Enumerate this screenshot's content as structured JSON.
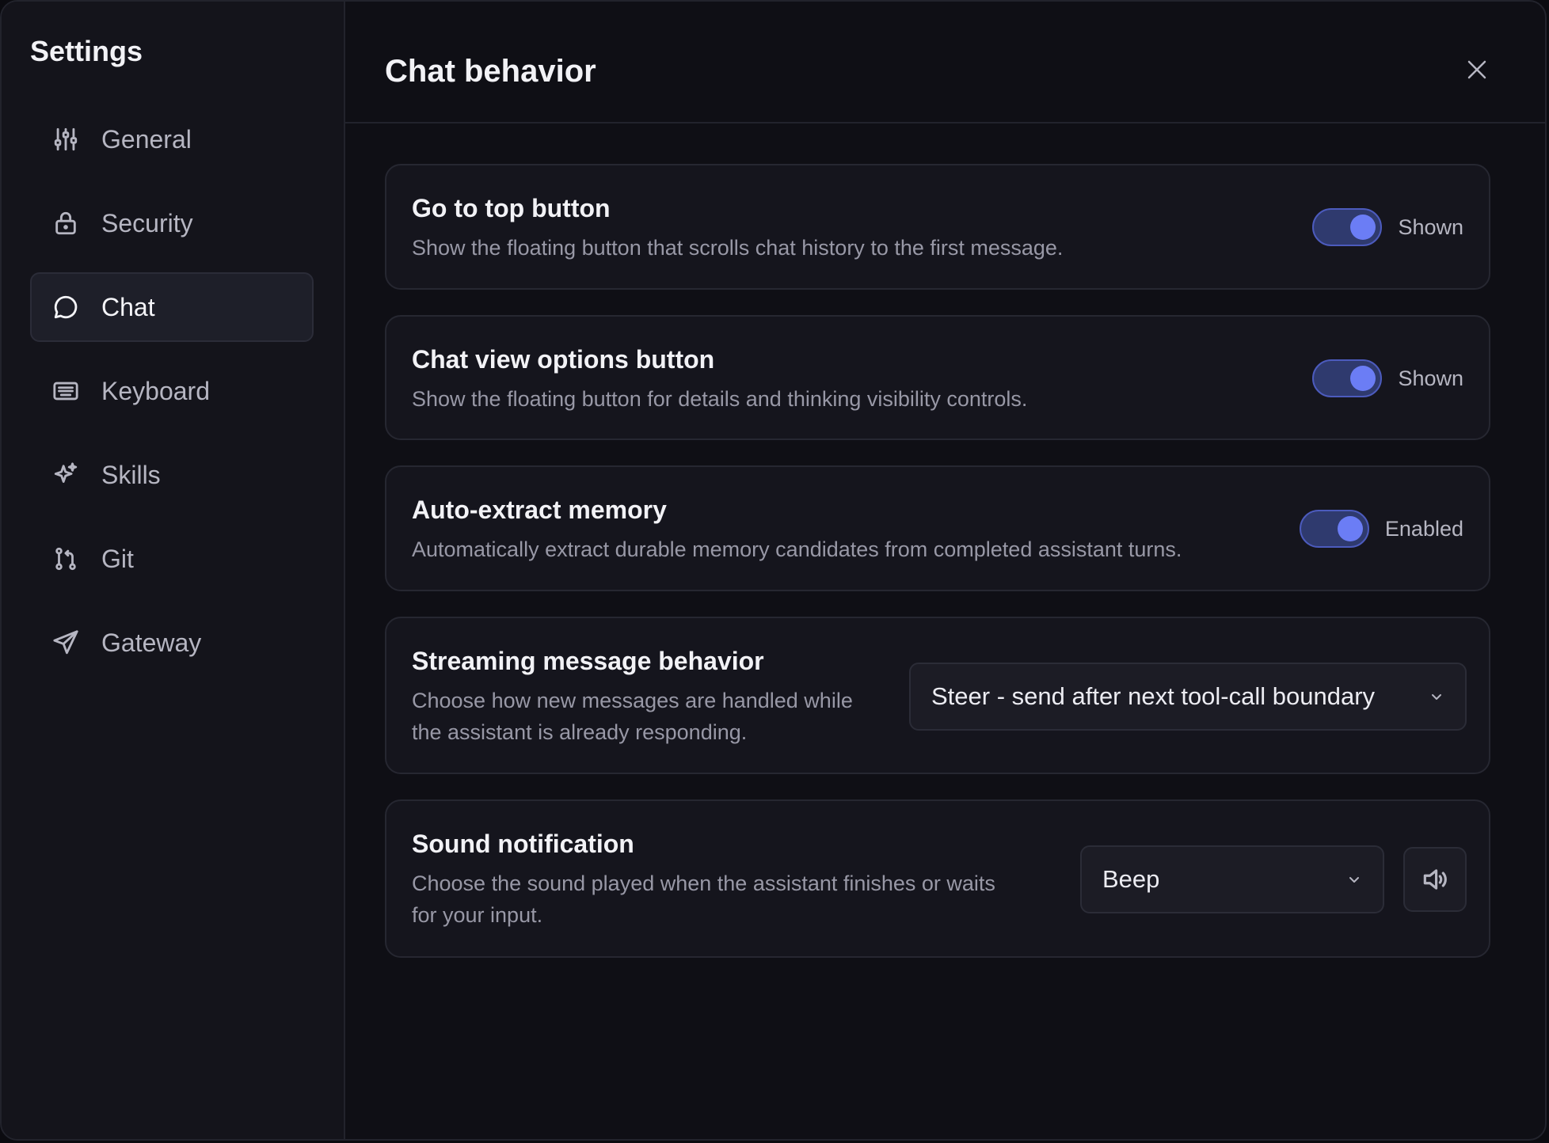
{
  "sidebar": {
    "title": "Settings",
    "items": [
      {
        "label": "General",
        "icon": "sliders-icon"
      },
      {
        "label": "Security",
        "icon": "lock-icon"
      },
      {
        "label": "Chat",
        "icon": "chat-bubble-icon",
        "active": true
      },
      {
        "label": "Keyboard",
        "icon": "keyboard-icon"
      },
      {
        "label": "Skills",
        "icon": "sparkle-icon"
      },
      {
        "label": "Git",
        "icon": "git-branch-icon"
      },
      {
        "label": "Gateway",
        "icon": "send-icon"
      }
    ]
  },
  "header": {
    "title": "Chat behavior",
    "close_icon": "close-icon"
  },
  "settings": {
    "go_to_top": {
      "title": "Go to top button",
      "description": "Show the floating button that scrolls chat history to the first message.",
      "state": "Shown",
      "on": true
    },
    "view_options": {
      "title": "Chat view options button",
      "description": "Show the floating button for details and thinking visibility controls.",
      "state": "Shown",
      "on": true
    },
    "auto_extract": {
      "title": "Auto-extract memory",
      "description": "Automatically extract durable memory candidates from completed assistant turns.",
      "state": "Enabled",
      "on": true
    },
    "streaming": {
      "title": "Streaming message behavior",
      "description_line1": "Choose how new messages are handled while",
      "description_line2": "the assistant is already responding.",
      "selected": "Steer - send after next tool-call boundary"
    },
    "sound": {
      "title": "Sound notification",
      "description_line1": "Choose the sound played when the assistant finishes or waits",
      "description_line2": "for your input.",
      "selected": "Beep",
      "preview_icon": "speaker-icon"
    }
  },
  "colors": {
    "accent": "#6b7df5",
    "toggle_track": "#2f3a6e",
    "background": "#0f0f15",
    "sidebar": "#14141b",
    "card": "#15151d"
  }
}
